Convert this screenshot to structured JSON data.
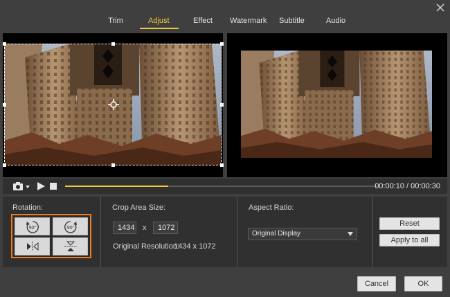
{
  "tabs": [
    {
      "label": "Trim",
      "active": false
    },
    {
      "label": "Adjust",
      "active": true
    },
    {
      "label": "Effect",
      "active": false
    },
    {
      "label": "Watermark",
      "active": false
    },
    {
      "label": "Subtitle",
      "active": false
    },
    {
      "label": "Audio",
      "active": false
    }
  ],
  "colors": {
    "accent": "#f3c93a",
    "highlight_border": "#f07a1e"
  },
  "playback": {
    "current_time": "00:00:10",
    "total_time": "00:00:30",
    "time_display": "00:00:10 / 00:00:30",
    "progress_percent": 33
  },
  "rotation": {
    "title": "Rotation:",
    "buttons": [
      {
        "label": "90°",
        "action": "rotate-counterclockwise"
      },
      {
        "label": "90°",
        "action": "rotate-clockwise"
      },
      {
        "action": "flip-horizontal"
      },
      {
        "action": "flip-vertical"
      }
    ]
  },
  "crop": {
    "title": "Crop Area Size:",
    "width": "1434",
    "separator": "x",
    "height": "1072",
    "original_label": "Original Resolution:",
    "original_value": "1434 x 1072"
  },
  "aspect": {
    "title": "Aspect Ratio:",
    "selected": "Original Display"
  },
  "actions": {
    "reset": "Reset",
    "apply_all": "Apply to all"
  },
  "footer": {
    "cancel": "Cancel",
    "ok": "OK"
  }
}
